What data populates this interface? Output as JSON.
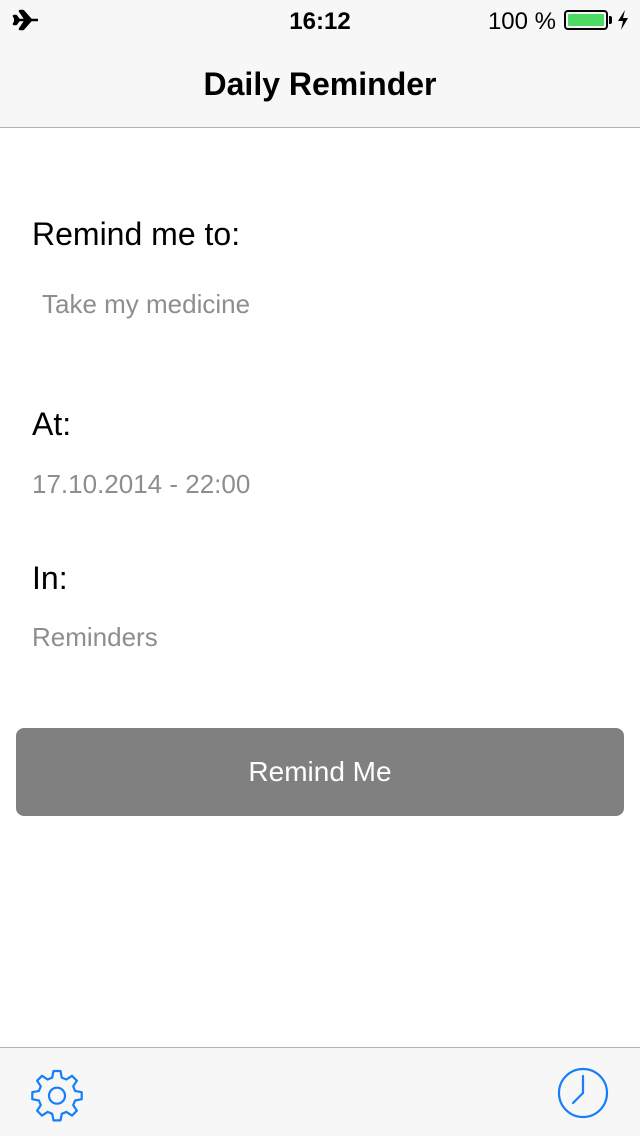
{
  "status_bar": {
    "time": "16:12",
    "battery_text": "100 %",
    "battery_level": 1.0,
    "battery_color": "#4cd964",
    "left_icon": "airplane-mode-icon",
    "charging_icon": "charging-bolt-icon"
  },
  "nav": {
    "title": "Daily Reminder"
  },
  "form": {
    "remind_label": "Remind me to:",
    "remind_placeholder": "Take my medicine",
    "remind_value": "",
    "at_label": "At:",
    "at_value": "17.10.2014 - 22:00",
    "in_label": "In:",
    "in_value": "Reminders",
    "button_label": "Remind Me",
    "button_color": "#808080"
  },
  "tab_bar": {
    "left_icon": "gear-icon",
    "right_icon": "clock-icon",
    "accent": "#147efb"
  }
}
